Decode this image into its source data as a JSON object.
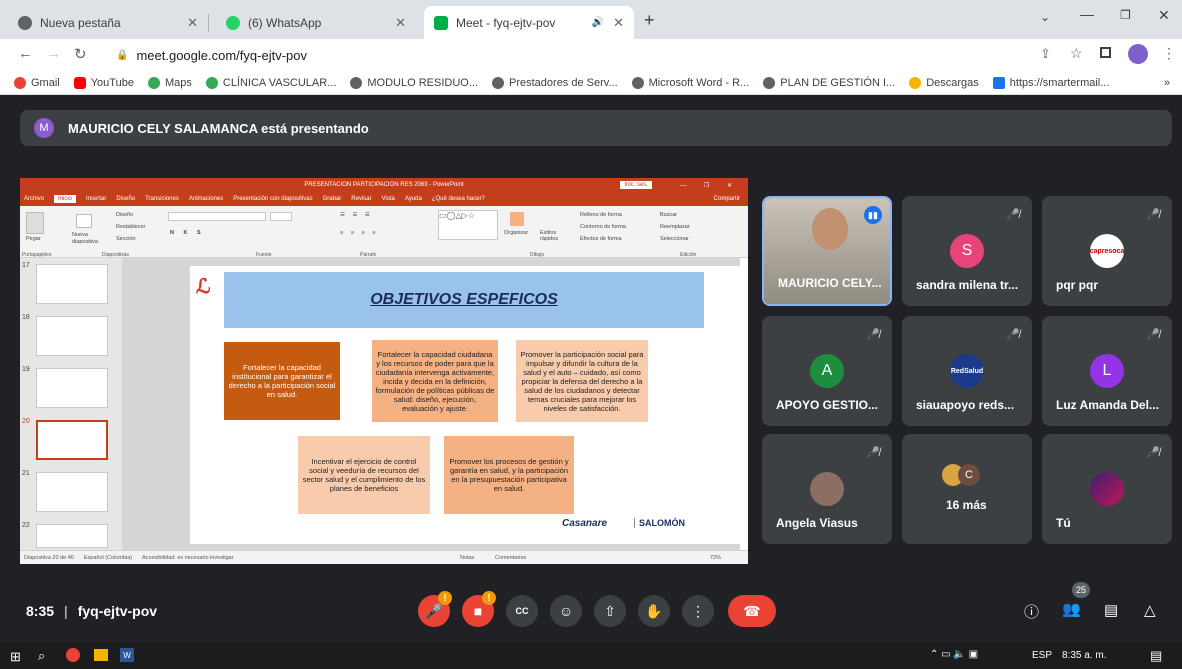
{
  "tabs": [
    {
      "title": "Nueva pestaña",
      "color": "#5f6368"
    },
    {
      "title": "(6) WhatsApp",
      "color": "#25d366"
    },
    {
      "title": "Meet - fyq-ejtv-pov",
      "color": "#00ac47"
    }
  ],
  "address": "meet.google.com/fyq-ejtv-pov",
  "bookmarks": [
    {
      "label": "Gmail",
      "color": "#ea4335"
    },
    {
      "label": "YouTube",
      "color": "#ff0000"
    },
    {
      "label": "Maps",
      "color": "#34a853"
    },
    {
      "label": "CLÍNICA VASCULAR...",
      "color": "#34a853"
    },
    {
      "label": "MODULO RESIDUO...",
      "color": "#5f6368"
    },
    {
      "label": "Prestadores de Serv...",
      "color": "#5f6368"
    },
    {
      "label": "Microsoft Word - R...",
      "color": "#5f6368"
    },
    {
      "label": "PLAN DE GESTIÓN I...",
      "color": "#5f6368"
    },
    {
      "label": "Descargas",
      "color": "#f4b400"
    },
    {
      "label": "https://smartermail...",
      "color": "#1a73e8"
    }
  ],
  "banner": {
    "initial": "M",
    "text": "MAURICIO CELY SALAMANCA está presentando"
  },
  "ppt": {
    "title": "PRESENTACION PARTICIPACION RES 2063 - PowerPoint",
    "user": "Inic. ses.",
    "tabs": [
      "Archivo",
      "Inicio",
      "Insertar",
      "Diseño",
      "Transiciones",
      "Animaciones",
      "Presentación con diapositivas",
      "Grabar",
      "Revisar",
      "Vista",
      "Ayuda",
      "¿Qué desea hacer?"
    ],
    "share": "Compartir",
    "groups": [
      "Portapapeles",
      "Diapositivas",
      "Fuente",
      "Párrafo",
      "Dibujo",
      "Edición"
    ],
    "ribbon": {
      "paste": "Pegar",
      "new_slide": "Nueva diapositiva",
      "layout": "Diseño",
      "reset": "Restablecer",
      "section": "Sección",
      "arrange": "Organizar",
      "styles": "Estilos rápidos",
      "fill": "Relleno de forma",
      "outline": "Contorno de forma",
      "effects": "Efectos de forma",
      "find": "Buscar",
      "replace": "Reemplazar",
      "select": "Seleccionar"
    },
    "thumb_numbers": [
      "17",
      "18",
      "19",
      "20",
      "21",
      "22"
    ],
    "slide_title": "OBJETIVOS ESPEFICOS",
    "boxes": [
      "Fortalecer la capacidad institucional para garantizar el derecho a la participación social en salud.",
      "Fortalecer la capacidad ciudadana y los recursos de poder para que la ciudadanía intervenga activamente, incida y decida en la definición, formulación de políticas públicas de salud: diseño, ejecución, evaluación y ajuste.",
      "Promover la participación social para impulsar y difundir la cultura de la salud y el auto – cuidado, así como propiciar la defensa del derecho a la salud de los ciudadanos y detectar temas cruciales para mejorar los niveles de satisfacción.",
      "Incentivar el ejercicio de control social y veeduría de recursos del sector salud y el cumplimiento de los planes de beneficios",
      "Promover los procesos de gestión y garantía en salud, y la participación en la presupuestación participativa en salud."
    ],
    "logo1": "Casanare",
    "logo2": "SALOMÓN",
    "status": [
      "Diapositiva 20 de 46",
      "Español (Colombia)",
      "Accesibilidad: es necesario investigar"
    ],
    "status_right": [
      "Notas",
      "Comentarios",
      "72%"
    ]
  },
  "tiles": [
    {
      "name": "MAURICIO CELY...",
      "type": "video"
    },
    {
      "name": "sandra milena tr...",
      "initial": "S",
      "color": "#e8437b"
    },
    {
      "name": "pqr pqr",
      "logo": "capresoca"
    },
    {
      "name": "APOYO GESTIO...",
      "initial": "A",
      "color": "#1e8e3e"
    },
    {
      "name": "siauapoyo reds...",
      "logo": "RedSalud"
    },
    {
      "name": "Luz Amanda Del...",
      "initial": "L",
      "color": "#9334e6"
    },
    {
      "name": "Angela Viasus",
      "type": "photo"
    },
    {
      "name": "16 más",
      "initial": "C",
      "color": "#6d4c41"
    },
    {
      "name": "Tú",
      "type": "photo"
    }
  ],
  "meeting": {
    "time": "8:35",
    "code": "fyq-ejtv-pov",
    "sep": "|",
    "participants": "25"
  },
  "taskbar": {
    "lang": "ESP",
    "time": "8:35 a. m."
  }
}
